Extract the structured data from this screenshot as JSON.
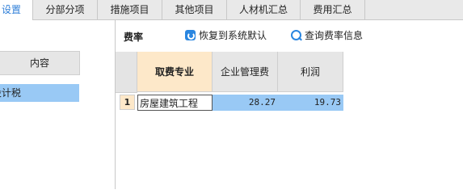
{
  "tabs": [
    {
      "label": "设置",
      "active": true
    },
    {
      "label": "分部分项",
      "active": false
    },
    {
      "label": "措施项目",
      "active": false
    },
    {
      "label": "其他项目",
      "active": false
    },
    {
      "label": "人材机汇总",
      "active": false
    },
    {
      "label": "费用汇总",
      "active": false
    }
  ],
  "left_panel": {
    "column_header": "内容",
    "selected_item": "设计税"
  },
  "toolbar": {
    "title": "费率",
    "restore_label": "恢复到系统默认",
    "query_label": "查询费率信息",
    "restore_icon": "restore-icon",
    "query_icon": "search-icon"
  },
  "grid": {
    "headers": [
      "取费专业",
      "企业管理费",
      "利润"
    ],
    "rows": [
      {
        "num": "1",
        "specialty": "房屋建筑工程",
        "mgmt_fee": "28.27",
        "profit": "19.73"
      }
    ]
  },
  "colors": {
    "accent": "#2f7fd8",
    "selection": "#99c9f5",
    "highlight_header": "#fde8c9"
  }
}
